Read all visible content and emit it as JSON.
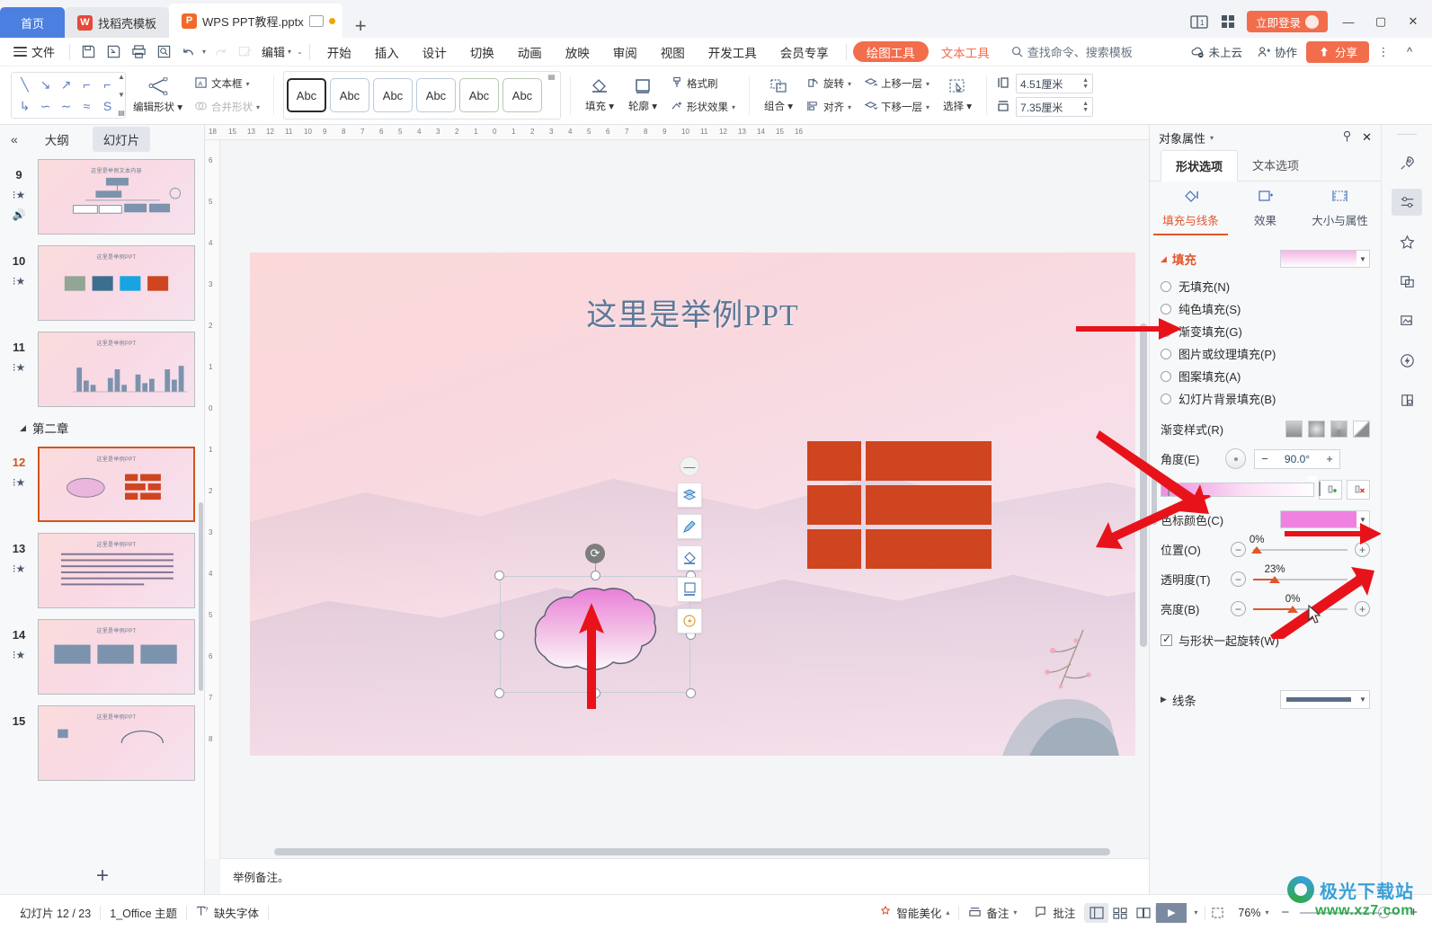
{
  "window": {
    "tabs": [
      {
        "label": "首页",
        "icon": "home-tab"
      },
      {
        "label": "找稻壳模板",
        "icon": "docer-icon"
      },
      {
        "label": "WPS PPT教程.pptx",
        "icon": "ppt-file-icon"
      }
    ],
    "new_tab": "+",
    "login_label": "立即登录"
  },
  "menu": {
    "file_label": "文件",
    "edit_label": "编辑",
    "tabs": [
      "开始",
      "插入",
      "设计",
      "切换",
      "动画",
      "放映",
      "审阅",
      "视图",
      "开发工具",
      "会员专享"
    ],
    "context_tabs": [
      {
        "label": "绘图工具",
        "active": true
      },
      {
        "label": "文本工具",
        "active": false
      }
    ],
    "search_placeholder": "查找命令、搜索模板",
    "cloud_status": "未上云",
    "collab_label": "协作",
    "share_label": "分享"
  },
  "ribbon": {
    "edit_shape_label": "编辑形状",
    "textbox_label": "文本框",
    "merge_shape_label": "合并形状",
    "style_samples": [
      "Abc",
      "Abc",
      "Abc",
      "Abc",
      "Abc",
      "Abc"
    ],
    "fill_label": "填充",
    "outline_label": "轮廓",
    "format_brush_label": "格式刷",
    "shape_effect_label": "形状效果",
    "group_label": "组合",
    "rotate_label": "旋转",
    "align_label": "对齐",
    "bring_forward_label": "上移一层",
    "send_backward_label": "下移一层",
    "select_label": "选择",
    "height_value": "4.51厘米",
    "width_value": "7.35厘米"
  },
  "left_panel": {
    "outline_tab": "大纲",
    "slides_tab": "幻灯片",
    "section_label": "第二章",
    "slides": [
      {
        "num": "9",
        "title": "这里是举例文本内容",
        "kind": "org-chart",
        "selected": false
      },
      {
        "num": "10",
        "title": "这里是举例PPT",
        "kind": "images",
        "selected": false
      },
      {
        "num": "11",
        "title": "这里是举例PPT",
        "kind": "bar-chart",
        "selected": false
      },
      {
        "num": "12",
        "title": "这里是举例PPT",
        "kind": "cloud-ppt",
        "selected": true
      },
      {
        "num": "13",
        "title": "这里是举例PPT",
        "kind": "text-body",
        "selected": false
      },
      {
        "num": "14",
        "title": "这里是举例PPT",
        "kind": "three-boxes",
        "selected": false
      },
      {
        "num": "15",
        "title": "这里是举例PPT",
        "kind": "diagram",
        "selected": false
      }
    ],
    "add_slide": "+"
  },
  "canvas": {
    "slide_title": "这里是举例PPT",
    "notes_text": "举例备注。",
    "ruler_h": [
      "18",
      "15",
      "13",
      "12",
      "11",
      "10",
      "9",
      "8",
      "7",
      "6",
      "5",
      "4",
      "3",
      "2",
      "1",
      "0",
      "1",
      "2",
      "3",
      "4",
      "5",
      "6",
      "7",
      "8",
      "9",
      "10",
      "11",
      "12",
      "13",
      "14",
      "15",
      "16"
    ],
    "ruler_v": [
      "6",
      "5",
      "4",
      "3",
      "2",
      "1",
      "0",
      "1",
      "2",
      "3",
      "4",
      "5",
      "6",
      "7",
      "8"
    ],
    "float_tools": [
      {
        "name": "layout-icon",
        "glyph": "◈"
      },
      {
        "name": "brush-icon",
        "glyph": "✐"
      },
      {
        "name": "fill-icon",
        "glyph": "◇"
      },
      {
        "name": "frame-icon",
        "glyph": "▣"
      },
      {
        "name": "idea-icon",
        "glyph": "◉"
      }
    ]
  },
  "right_panel": {
    "title": "对象属性",
    "tabs": [
      {
        "label": "形状选项",
        "active": true
      },
      {
        "label": "文本选项",
        "active": false
      }
    ],
    "sub_tabs": [
      {
        "label": "填充与线条",
        "icon": "fill-line-icon",
        "active": true
      },
      {
        "label": "效果",
        "icon": "effects-icon",
        "active": false
      },
      {
        "label": "大小与属性",
        "icon": "size-props-icon",
        "active": false
      }
    ],
    "fill_section": {
      "title": "填充",
      "options": [
        {
          "label": "无填充(N)",
          "accel": "N",
          "selected": false
        },
        {
          "label": "纯色填充(S)",
          "accel": "S",
          "selected": false
        },
        {
          "label": "渐变填充(G)",
          "accel": "G",
          "selected": true
        },
        {
          "label": "图片或纹理填充(P)",
          "accel": "P",
          "selected": false
        },
        {
          "label": "图案填充(A)",
          "accel": "A",
          "selected": false
        },
        {
          "label": "幻灯片背景填充(B)",
          "accel": "B",
          "selected": false
        }
      ],
      "gradient_style_label": "渐变样式(R)",
      "angle_label": "角度(E)",
      "angle_value": "90.0°",
      "stop_color_label": "色标颜色(C)",
      "stop_color_hex": "#ef82e0",
      "position_label": "位置(O)",
      "position_value": "0%",
      "transparency_label": "透明度(T)",
      "transparency_value": "23%",
      "brightness_label": "亮度(B)",
      "brightness_value": "0%",
      "rotate_with_shape_label": "与形状一起旋转(W)",
      "rotate_with_shape_checked": true
    },
    "line_section_label": "线条"
  },
  "status_bar": {
    "slide_counter": "幻灯片 12 / 23",
    "theme": "1_Office 主题",
    "missing_fonts": "缺失字体",
    "smart_beautify": "智能美化",
    "notes_label": "备注",
    "comments_label": "批注",
    "zoom_value": "76%"
  },
  "watermark": {
    "line1": "极光下载站",
    "line2": "www.xz7.com"
  },
  "colors": {
    "accent_orange": "#f26d4c",
    "accent_blue": "#4b7fe0",
    "panel_highlight": "#e2562a",
    "gradient_stop": "#ef82e0"
  }
}
